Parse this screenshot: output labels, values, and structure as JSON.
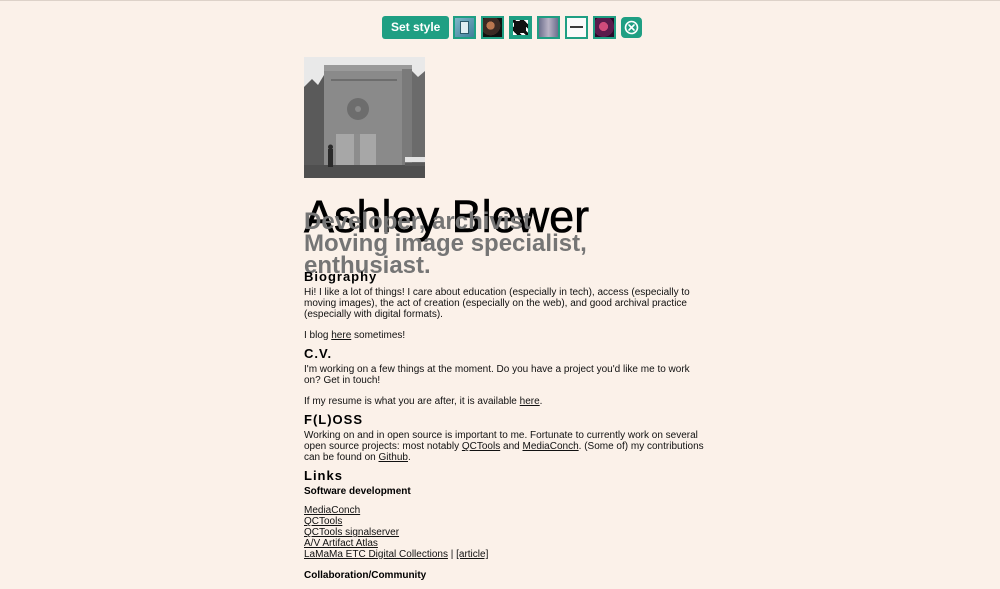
{
  "toolbar": {
    "set_style_label": "Set style",
    "swatches": [
      "style-swatch-1",
      "style-swatch-2",
      "style-swatch-3",
      "style-swatch-4",
      "style-swatch-5",
      "style-swatch-6"
    ],
    "close_icon": "close-icon",
    "accent": "#1f9f83"
  },
  "profile": {
    "name": "Ashley Blewer",
    "taglines": [
      "Developer, archivist",
      "Moving image specialist,",
      "enthusiast."
    ]
  },
  "biography": {
    "heading": "Biography",
    "text": "Hi! I like a lot of things! I care about education (especially in tech), access (especially to moving images), the act of creation (especially on the web), and good archival practice (especially with digital formats).",
    "blog_prefix": "I blog ",
    "blog_link": "here",
    "blog_suffix": " sometimes!"
  },
  "cv": {
    "heading": "C.V.",
    "text": "I'm working on a few things at the moment. Do you have a project you'd like me to work on? Get in touch!",
    "resume_prefix": "If my resume is what you are after, it is available ",
    "resume_link": "here",
    "resume_suffix": "."
  },
  "floss": {
    "heading": "F(L)OSS",
    "text_a": "Working on and in open source is important to me. Fortunate to currently work on several open source projects: most notably ",
    "link_qctools": "QCTools",
    "text_b": " and ",
    "link_mediaconch": "MediaConch",
    "text_c": ". (Some of) my contributions can be found on ",
    "link_github": "Github",
    "text_d": "."
  },
  "links": {
    "heading": "Links",
    "software_heading": "Software development",
    "software": [
      "MediaConch",
      "QCTools",
      "QCTools signalserver",
      "A/V Artifact Atlas",
      "LaMaMa ETC Digital Collections"
    ],
    "separator": " | ",
    "article_link": "[article]",
    "collab_heading": "Collaboration/Community"
  }
}
